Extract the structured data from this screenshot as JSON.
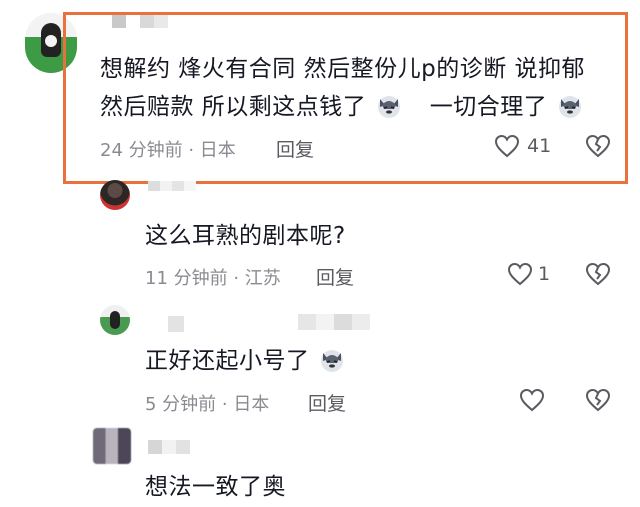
{
  "comments": [
    {
      "text_parts": [
        "想解约 烽火有合同 然后整份儿p的诊断 说抑郁",
        "然后赔款 所以剩这点钱了",
        "一切合理了"
      ],
      "time": "24 分钟前 · 日本",
      "reply_label": "回复",
      "likes": "41"
    },
    {
      "text": "这么耳熟的剧本呢?",
      "time": "11 分钟前 · 江苏",
      "reply_label": "回复",
      "likes": "1"
    },
    {
      "text": "正好还起小号了",
      "time": "5 分钟前 · 日本",
      "reply_label": "回复",
      "likes": ""
    },
    {
      "text": "想法一致了奥"
    }
  ],
  "colors": {
    "highlight_border": "#e8713d",
    "text": "#161823",
    "meta": "#8a8b91"
  },
  "icons": [
    "heart-outline-icon",
    "broken-heart-icon",
    "husky-emoji-icon"
  ]
}
